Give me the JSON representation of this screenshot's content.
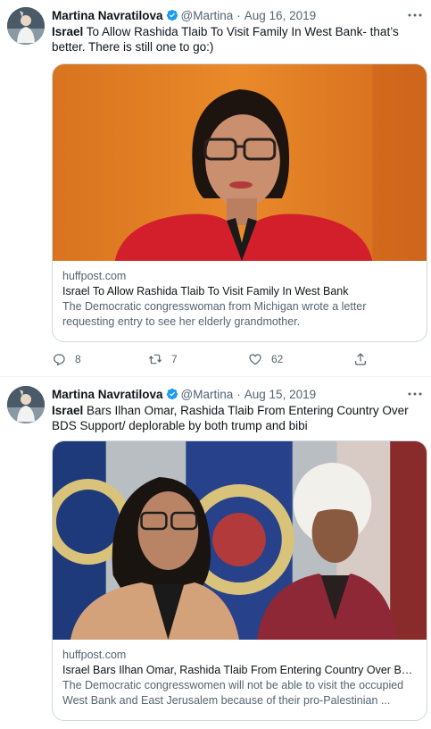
{
  "tweets": [
    {
      "author_name": "Martina Navratilova",
      "handle": "@Martina",
      "separator": "·",
      "date": "Aug 16, 2019",
      "text_bold": "Israel",
      "text_rest": " To Allow Rashida Tlaib To Visit Family In West Bank- that’s better. There is still one to go:)",
      "card": {
        "domain": "huffpost.com",
        "title": "Israel To Allow Rashida Tlaib To Visit Family In West Bank",
        "description": "The Democratic congresswoman from Michigan wrote a letter requesting entry to see her elderly grandmother."
      },
      "actions": {
        "replies": "8",
        "retweets": "7",
        "likes": "62"
      }
    },
    {
      "author_name": "Martina Navratilova",
      "handle": "@Martina",
      "separator": "·",
      "date": "Aug 15, 2019",
      "text_bold": "Israel",
      "text_rest": " Bars Ilhan Omar, Rashida Tlaib From Entering Country Over BDS Support/ deplorable by both trump and bibi",
      "card": {
        "domain": "huffpost.com",
        "title": "Israel Bars Ilhan Omar, Rashida Tlaib From Entering Country Over BDS...",
        "description": "The Democratic congresswomen will not be able to visit the occupied West Bank and East Jerusalem because of their pro-Palestinian ..."
      }
    }
  ],
  "icons": {
    "verified": "verified-badge-icon",
    "more": "more-options-icon",
    "reply": "reply-icon",
    "retweet": "retweet-icon",
    "like": "like-icon",
    "share": "share-icon"
  },
  "colors": {
    "verified": "#1d9bf0",
    "secondary_text": "#536471",
    "border": "#cfd9de"
  }
}
